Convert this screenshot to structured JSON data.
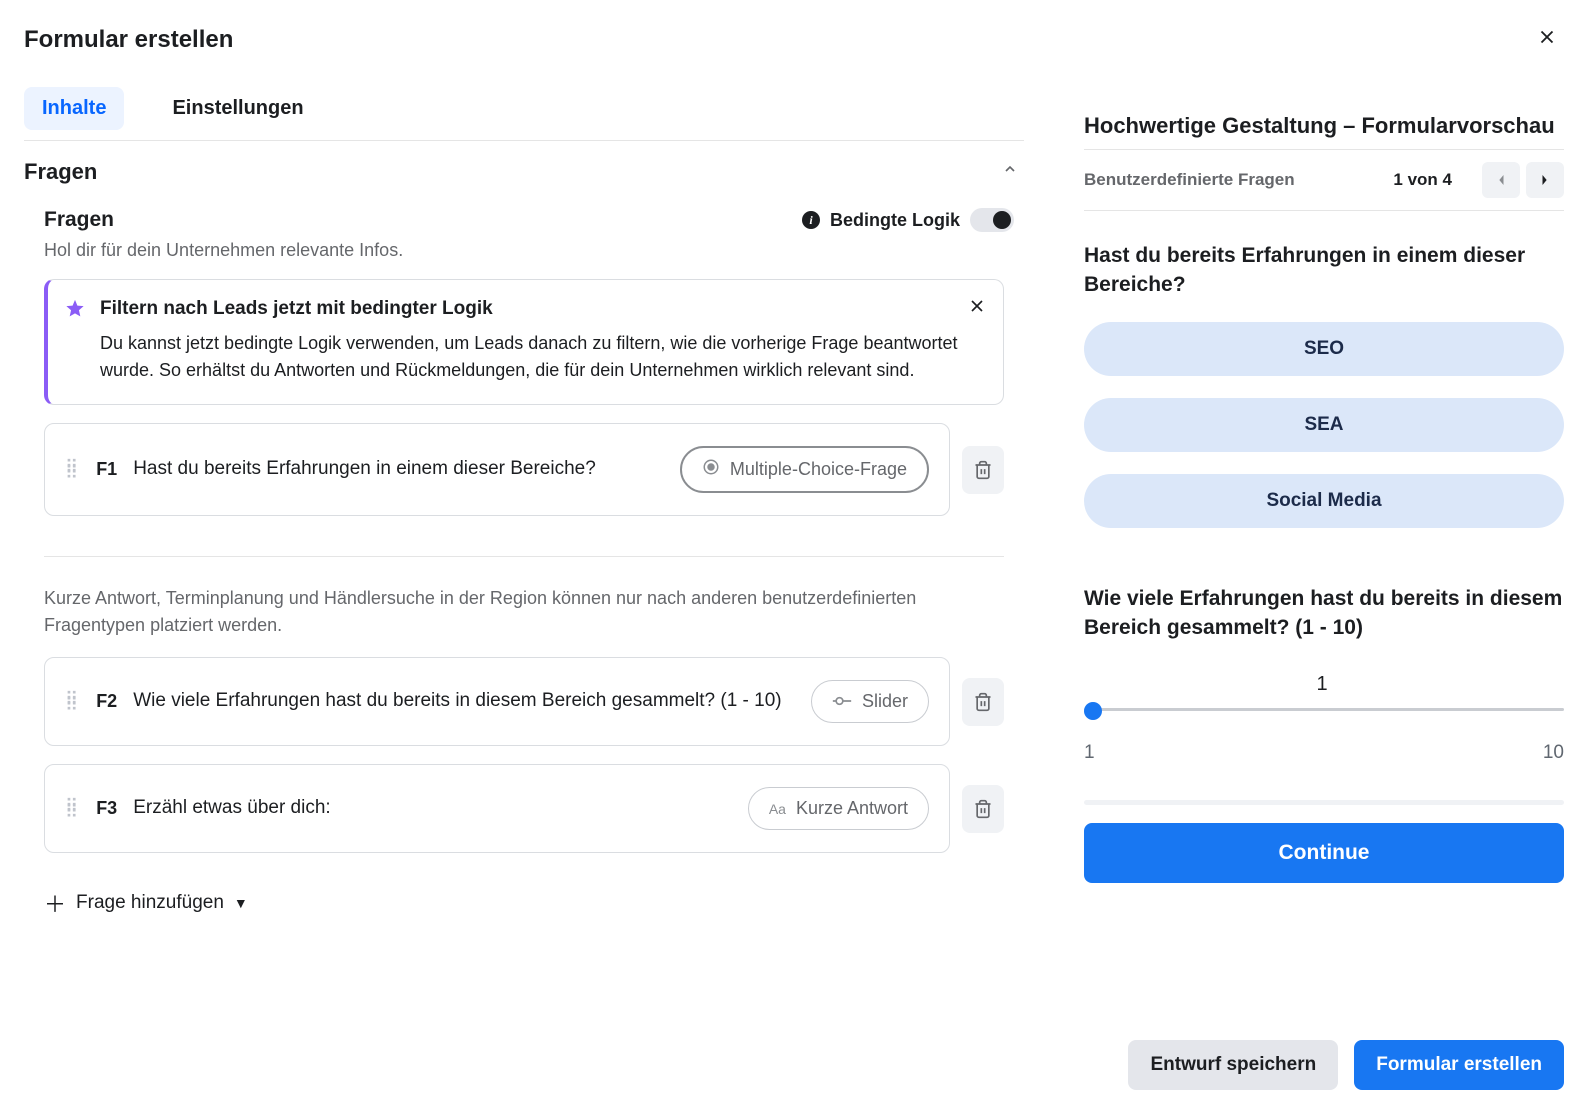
{
  "header": {
    "title": "Formular erstellen"
  },
  "tabs": {
    "active": "Inhalte",
    "inactive": "Einstellungen"
  },
  "section": {
    "title": "Fragen",
    "sub_title": "Fragen",
    "sub_desc": "Hol dir für dein Unternehmen relevante Infos.",
    "logic_label": "Bedingte Logik"
  },
  "banner": {
    "title": "Filtern nach Leads jetzt mit bedingter Logik",
    "body": "Du kannst jetzt bedingte Logik verwenden, um Leads danach zu filtern, wie die vorherige Frage beantwortet wurde. So erhältst du Antworten und Rückmeldungen, die für dein Unternehmen wirklich relevant sind."
  },
  "questions": [
    {
      "num": "F1",
      "text": "Hast du bereits Erfahrungen in einem dieser Bereiche?",
      "type_label": "Multiple-Choice-Frage"
    },
    {
      "num": "F2",
      "text": "Wie viele Erfahrungen hast du bereits in diesem Bereich gesammelt? (1 - 10)",
      "type_label": "Slider"
    },
    {
      "num": "F3",
      "text": "Erzähl etwas über dich:",
      "type_label": "Kurze Antwort"
    }
  ],
  "note": "Kurze Antwort, Terminplanung und Händlersuche in der Region können nur nach anderen benutzerdefinierten Fragentypen platziert werden.",
  "add_question": "Frage hinzufügen",
  "preview": {
    "title": "Hochwertige Gestaltung – Formularvorschau",
    "pager_label": "Benutzerdefinierte Fragen",
    "pager_info": "1 von 4",
    "q1": "Hast du bereits Erfahrungen in einem dieser Bereiche?",
    "options": [
      "SEO",
      "SEA",
      "Social Media"
    ],
    "q2": "Wie viele Erfahrungen hast du bereits in diesem Bereich gesammelt? (1 - 10)",
    "slider_value": "1",
    "slider_min": "1",
    "slider_max": "10",
    "continue": "Continue"
  },
  "footer": {
    "draft": "Entwurf speichern",
    "create": "Formular erstellen"
  }
}
